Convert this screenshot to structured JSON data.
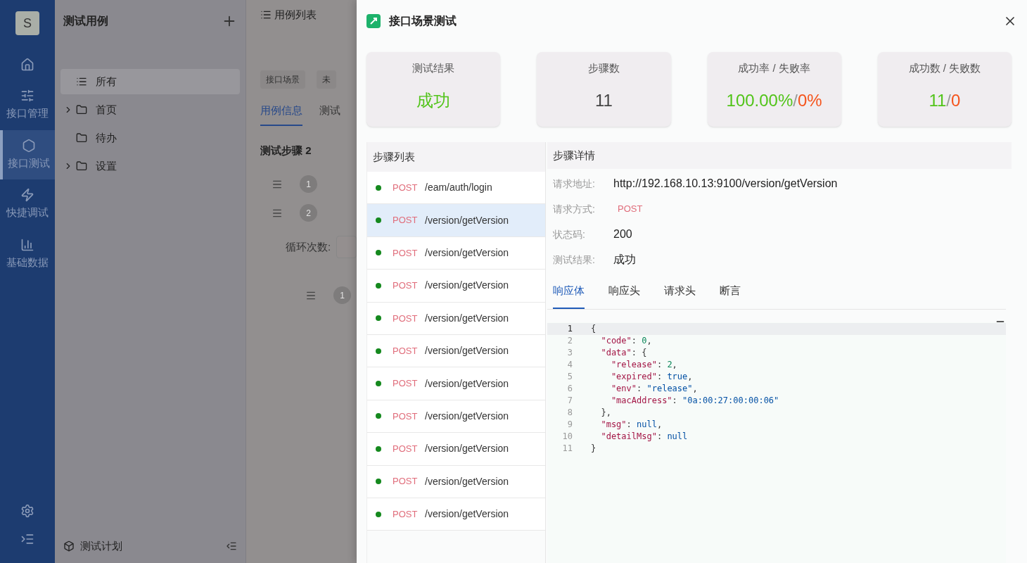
{
  "nav": {
    "avatar": "S",
    "items": [
      {
        "selected": false
      },
      {
        "label": "接口管理",
        "selected": false
      },
      {
        "label": "接口测试",
        "selected": true
      },
      {
        "label": "快捷调试",
        "selected": false
      },
      {
        "label": "基础数据",
        "selected": false
      }
    ]
  },
  "tree": {
    "title": "测试用例",
    "items": [
      {
        "label": "所有",
        "kind": "all",
        "selected": true,
        "expandable": false
      },
      {
        "label": "首页",
        "kind": "folder",
        "selected": false,
        "expandable": true
      },
      {
        "label": "待办",
        "kind": "folder",
        "selected": false,
        "expandable": false
      },
      {
        "label": "设置",
        "kind": "folder",
        "selected": false,
        "expandable": true
      }
    ],
    "footer": "测试计划"
  },
  "case_panel": {
    "title": "用例列表",
    "tags": [
      "接口场景",
      "未"
    ],
    "tabs": [
      {
        "label": "用例信息",
        "selected": true
      },
      {
        "label": "测试",
        "selected": false
      }
    ],
    "steps_title": "测试步骤 2",
    "steps": [
      "1",
      "2"
    ],
    "loop_label": "循环次数:",
    "sub_steps": [
      "1"
    ]
  },
  "drawer": {
    "title": "接口场景测试",
    "stats": [
      {
        "label": "测试结果",
        "parts": [
          {
            "text": "成功",
            "color": "#52c41a"
          }
        ]
      },
      {
        "label": "步骤数",
        "parts": [
          {
            "text": "11",
            "color": "#444444"
          }
        ]
      },
      {
        "label": "成功率 / 失败率",
        "parts": [
          {
            "text": "100.00%",
            "color": "#52c41a"
          },
          {
            "text": "/",
            "color": "#999999"
          },
          {
            "text": "0%",
            "color": "#f5541c"
          }
        ]
      },
      {
        "label": "成功数 / 失败数",
        "parts": [
          {
            "text": "11",
            "color": "#52c41a"
          },
          {
            "text": "/",
            "color": "#999999"
          },
          {
            "text": "0",
            "color": "#f5541c"
          }
        ]
      }
    ],
    "step_list": {
      "title": "步骤列表",
      "rows": [
        {
          "method": "POST",
          "path": "/eam/auth/login",
          "color": "#15891e",
          "selected": false
        },
        {
          "method": "POST",
          "path": "/version/getVersion",
          "color": "#15891e",
          "selected": true
        },
        {
          "method": "POST",
          "path": "/version/getVersion",
          "color": "#15891e",
          "selected": false
        },
        {
          "method": "POST",
          "path": "/version/getVersion",
          "color": "#15891e",
          "selected": false
        },
        {
          "method": "POST",
          "path": "/version/getVersion",
          "color": "#15891e",
          "selected": false
        },
        {
          "method": "POST",
          "path": "/version/getVersion",
          "color": "#15891e",
          "selected": false
        },
        {
          "method": "POST",
          "path": "/version/getVersion",
          "color": "#15891e",
          "selected": false
        },
        {
          "method": "POST",
          "path": "/version/getVersion",
          "color": "#15891e",
          "selected": false
        },
        {
          "method": "POST",
          "path": "/version/getVersion",
          "color": "#15891e",
          "selected": false
        },
        {
          "method": "POST",
          "path": "/version/getVersion",
          "color": "#15891e",
          "selected": false
        },
        {
          "method": "POST",
          "path": "/version/getVersion",
          "color": "#15891e",
          "selected": false
        }
      ]
    },
    "detail": {
      "title": "步骤详情",
      "fields": [
        {
          "label": "请求地址:",
          "value": "http://192.168.10.13:9100/version/getVersion",
          "kind": "text"
        },
        {
          "label": "请求方式:",
          "value": "POST",
          "kind": "method"
        },
        {
          "label": "状态码:",
          "value": "200",
          "kind": "text"
        },
        {
          "label": "测试结果:",
          "value": "成功",
          "kind": "text"
        }
      ],
      "tabs": [
        {
          "label": "响应体",
          "selected": true
        },
        {
          "label": "响应头",
          "selected": false
        },
        {
          "label": "请求头",
          "selected": false
        },
        {
          "label": "断言",
          "selected": false
        }
      ],
      "code": [
        {
          "no": "1",
          "active": true,
          "tokens": [
            {
              "kind": "punct",
              "text": "{"
            }
          ]
        },
        {
          "no": "2",
          "active": false,
          "tokens": [
            {
              "kind": "key",
              "text": "  \"code\""
            },
            {
              "kind": "punct",
              "text": ": "
            },
            {
              "kind": "number",
              "text": "0"
            },
            {
              "kind": "punct",
              "text": ","
            }
          ]
        },
        {
          "no": "3",
          "active": false,
          "tokens": [
            {
              "kind": "key",
              "text": "  \"data\""
            },
            {
              "kind": "punct",
              "text": ": {"
            }
          ]
        },
        {
          "no": "4",
          "active": false,
          "tokens": [
            {
              "kind": "key",
              "text": "    \"release\""
            },
            {
              "kind": "punct",
              "text": ": "
            },
            {
              "kind": "number",
              "text": "2"
            },
            {
              "kind": "punct",
              "text": ","
            }
          ]
        },
        {
          "no": "5",
          "active": false,
          "tokens": [
            {
              "kind": "key",
              "text": "    \"expired\""
            },
            {
              "kind": "punct",
              "text": ": "
            },
            {
              "kind": "literal",
              "text": "true"
            },
            {
              "kind": "punct",
              "text": ","
            }
          ]
        },
        {
          "no": "6",
          "active": false,
          "tokens": [
            {
              "kind": "key",
              "text": "    \"env\""
            },
            {
              "kind": "punct",
              "text": ": "
            },
            {
              "kind": "string",
              "text": "\"release\""
            },
            {
              "kind": "punct",
              "text": ","
            }
          ]
        },
        {
          "no": "7",
          "active": false,
          "tokens": [
            {
              "kind": "key",
              "text": "    \"macAddress\""
            },
            {
              "kind": "punct",
              "text": ": "
            },
            {
              "kind": "string",
              "text": "\"0a:00:27:00:00:06\""
            }
          ]
        },
        {
          "no": "8",
          "active": false,
          "tokens": [
            {
              "kind": "punct",
              "text": "  },"
            }
          ]
        },
        {
          "no": "9",
          "active": false,
          "tokens": [
            {
              "kind": "key",
              "text": "  \"msg\""
            },
            {
              "kind": "punct",
              "text": ": "
            },
            {
              "kind": "literal",
              "text": "null"
            },
            {
              "kind": "punct",
              "text": ","
            }
          ]
        },
        {
          "no": "10",
          "active": false,
          "tokens": [
            {
              "kind": "key",
              "text": "  \"detailMsg\""
            },
            {
              "kind": "punct",
              "text": ": "
            },
            {
              "kind": "literal",
              "text": "null"
            }
          ]
        },
        {
          "no": "11",
          "active": false,
          "tokens": [
            {
              "kind": "punct",
              "text": "}"
            }
          ]
        }
      ]
    }
  }
}
